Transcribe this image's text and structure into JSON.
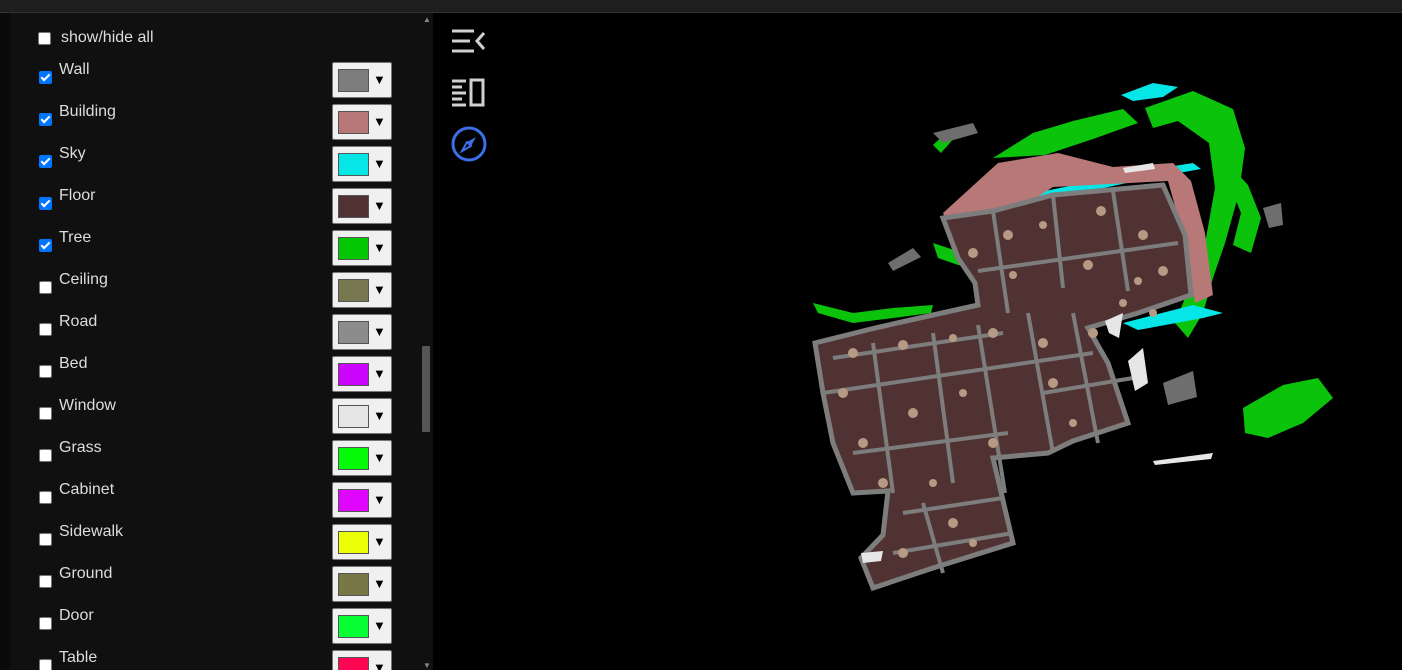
{
  "legend": {
    "show_all_label": "show/hide all",
    "show_all_checked": false,
    "items": [
      {
        "label": "Wall",
        "checked": true,
        "color": "#7d7d7d"
      },
      {
        "label": "Building",
        "checked": true,
        "color": "#b87878"
      },
      {
        "label": "Sky",
        "checked": true,
        "color": "#06e6e6"
      },
      {
        "label": "Floor",
        "checked": true,
        "color": "#503232"
      },
      {
        "label": "Tree",
        "checked": true,
        "color": "#04c804"
      },
      {
        "label": "Ceiling",
        "checked": false,
        "color": "#787850"
      },
      {
        "label": "Road",
        "checked": false,
        "color": "#8c8c8c"
      },
      {
        "label": "Bed",
        "checked": false,
        "color": "#cc05ff"
      },
      {
        "label": "Window",
        "checked": false,
        "color": "#e6e6e6"
      },
      {
        "label": "Grass",
        "checked": false,
        "color": "#04fa07"
      },
      {
        "label": "Cabinet",
        "checked": false,
        "color": "#e005ff"
      },
      {
        "label": "Sidewalk",
        "checked": false,
        "color": "#ebff07"
      },
      {
        "label": "Ground",
        "checked": false,
        "color": "#787846"
      },
      {
        "label": "Door",
        "checked": false,
        "color": "#08ff33"
      },
      {
        "label": "Table",
        "checked": false,
        "color": "#ff0652"
      }
    ]
  },
  "toolbar": {
    "icons": [
      "collapse-panel-icon",
      "toggle-sidebar-icon",
      "compass-icon"
    ],
    "accent_color": "#3b6fe8"
  }
}
